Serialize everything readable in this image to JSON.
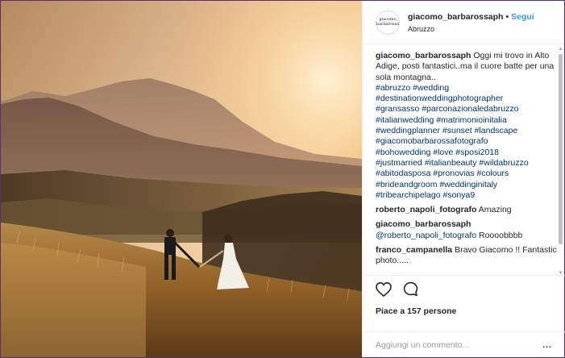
{
  "header": {
    "avatar_text": "giacomo barbarossa",
    "username": "giacomo_barbarossaph",
    "separator": "•",
    "follow_label": "Segui",
    "location": "Abruzzo"
  },
  "caption": {
    "user": "giacomo_barbarossaph",
    "text": "Oggi mi trovo in Alto Adige, posti fantastici..ma il cuore batte per una sola montagna..",
    "hashtags": [
      "#abruzzo #wedding",
      "#destinationweddingphotographer",
      "#gransasso #parconazionaledabruzzo",
      "#italianwedding #matrimonioinitalia",
      "#weddingplanner #sunset #landscape",
      "#giacomobarbarossafotografo",
      "#bohowedding #love #sposi2018",
      "#justmarried #italianbeauty #wildabruzzo",
      "#abitodasposa #pronovias #colours",
      "#brideandgroom #weddinginitaly",
      "#tribearchipelago #sonya9"
    ]
  },
  "comments": [
    {
      "user": "roberto_napoli_fotografo",
      "mention": "",
      "text": "Amazing"
    },
    {
      "user": "giacomo_barbarossaph",
      "mention": "@roberto_napoli_fotografo",
      "text": "Roooobbbb"
    },
    {
      "user": "franco_campanella",
      "mention": "",
      "text": "Bravo Giacomo !! Fantastic photo....."
    }
  ],
  "actions": {
    "like_icon": "heart-icon",
    "comment_icon": "comment-bubble-icon",
    "likes_text": "Piace a 157 persone"
  },
  "add_comment": {
    "placeholder": "Aggiungi un commento...",
    "more_label": "..."
  },
  "colors": {
    "link": "#003569",
    "follow": "#3897f0",
    "border": "#5b2c7a"
  }
}
